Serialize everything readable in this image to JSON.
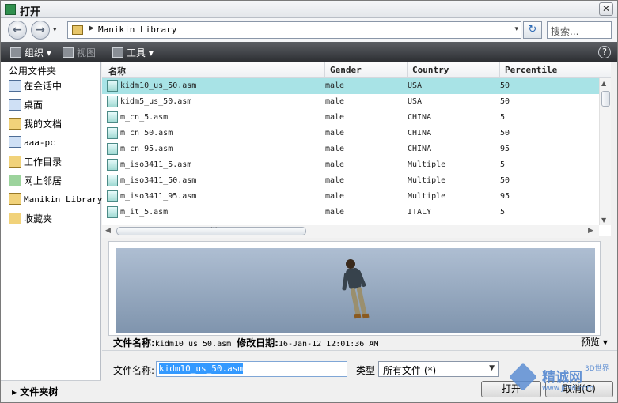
{
  "window": {
    "title": "打开",
    "close_glyph": "✕"
  },
  "nav": {
    "back_glyph": "←",
    "forward_glyph": "→",
    "dropdown_glyph": "▾",
    "address_arrow": "▶",
    "address": "Manikin Library",
    "refresh_glyph": "↻",
    "search_placeholder": "搜索..."
  },
  "toolbar": {
    "organize": "组织 ▾",
    "views": "视图",
    "tools": "工具 ▾",
    "help_glyph": "?"
  },
  "sidebar": {
    "header": "公用文件夹",
    "items": [
      {
        "label": "在会话中",
        "icon": "monitor-icon"
      },
      {
        "label": "桌面",
        "icon": "desktop-icon"
      },
      {
        "label": "我的文档",
        "icon": "documents-icon"
      },
      {
        "label": "aaa-pc",
        "icon": "computer-icon"
      },
      {
        "label": "工作目录",
        "icon": "working-directory-icon"
      },
      {
        "label": "网上邻居",
        "icon": "network-icon"
      },
      {
        "label": "Manikin Library",
        "icon": "folder-icon"
      },
      {
        "label": "收藏夹",
        "icon": "favorites-icon"
      }
    ],
    "folder_tree": "▸ 文件夹树"
  },
  "list": {
    "columns": [
      "名称",
      "Gender",
      "Country",
      "Percentile"
    ],
    "rows": [
      {
        "name": "kidm10_us_50.asm",
        "gender": "male",
        "country": "USA",
        "percentile": "50",
        "selected": true
      },
      {
        "name": "kidm5_us_50.asm",
        "gender": "male",
        "country": "USA",
        "percentile": "50"
      },
      {
        "name": "m_cn_5.asm",
        "gender": "male",
        "country": "CHINA",
        "percentile": "5"
      },
      {
        "name": "m_cn_50.asm",
        "gender": "male",
        "country": "CHINA",
        "percentile": "50"
      },
      {
        "name": "m_cn_95.asm",
        "gender": "male",
        "country": "CHINA",
        "percentile": "95"
      },
      {
        "name": "m_iso3411_5.asm",
        "gender": "male",
        "country": "Multiple",
        "percentile": "5"
      },
      {
        "name": "m_iso3411_50.asm",
        "gender": "male",
        "country": "Multiple",
        "percentile": "50"
      },
      {
        "name": "m_iso3411_95.asm",
        "gender": "male",
        "country": "Multiple",
        "percentile": "95"
      },
      {
        "name": "m_it_5.asm",
        "gender": "male",
        "country": "ITALY",
        "percentile": "5"
      }
    ]
  },
  "preview": {
    "file_label": "文件名称:",
    "file_value": "kidm10_us_50.asm",
    "date_label": "修改日期:",
    "date_value": "16-Jan-12 12:01:36 AM",
    "toggle": "预览 ▾"
  },
  "bottom": {
    "filename_label": "文件名称:",
    "filename_value": "kidm10_us_50.asm",
    "type_label": "类型",
    "type_value": "所有文件 (*)",
    "open_button": "打开",
    "cancel_button": "取消(C)"
  },
  "watermark": {
    "name": "精诚网",
    "tag": "3D世界",
    "url": "www.jc3d.com"
  }
}
